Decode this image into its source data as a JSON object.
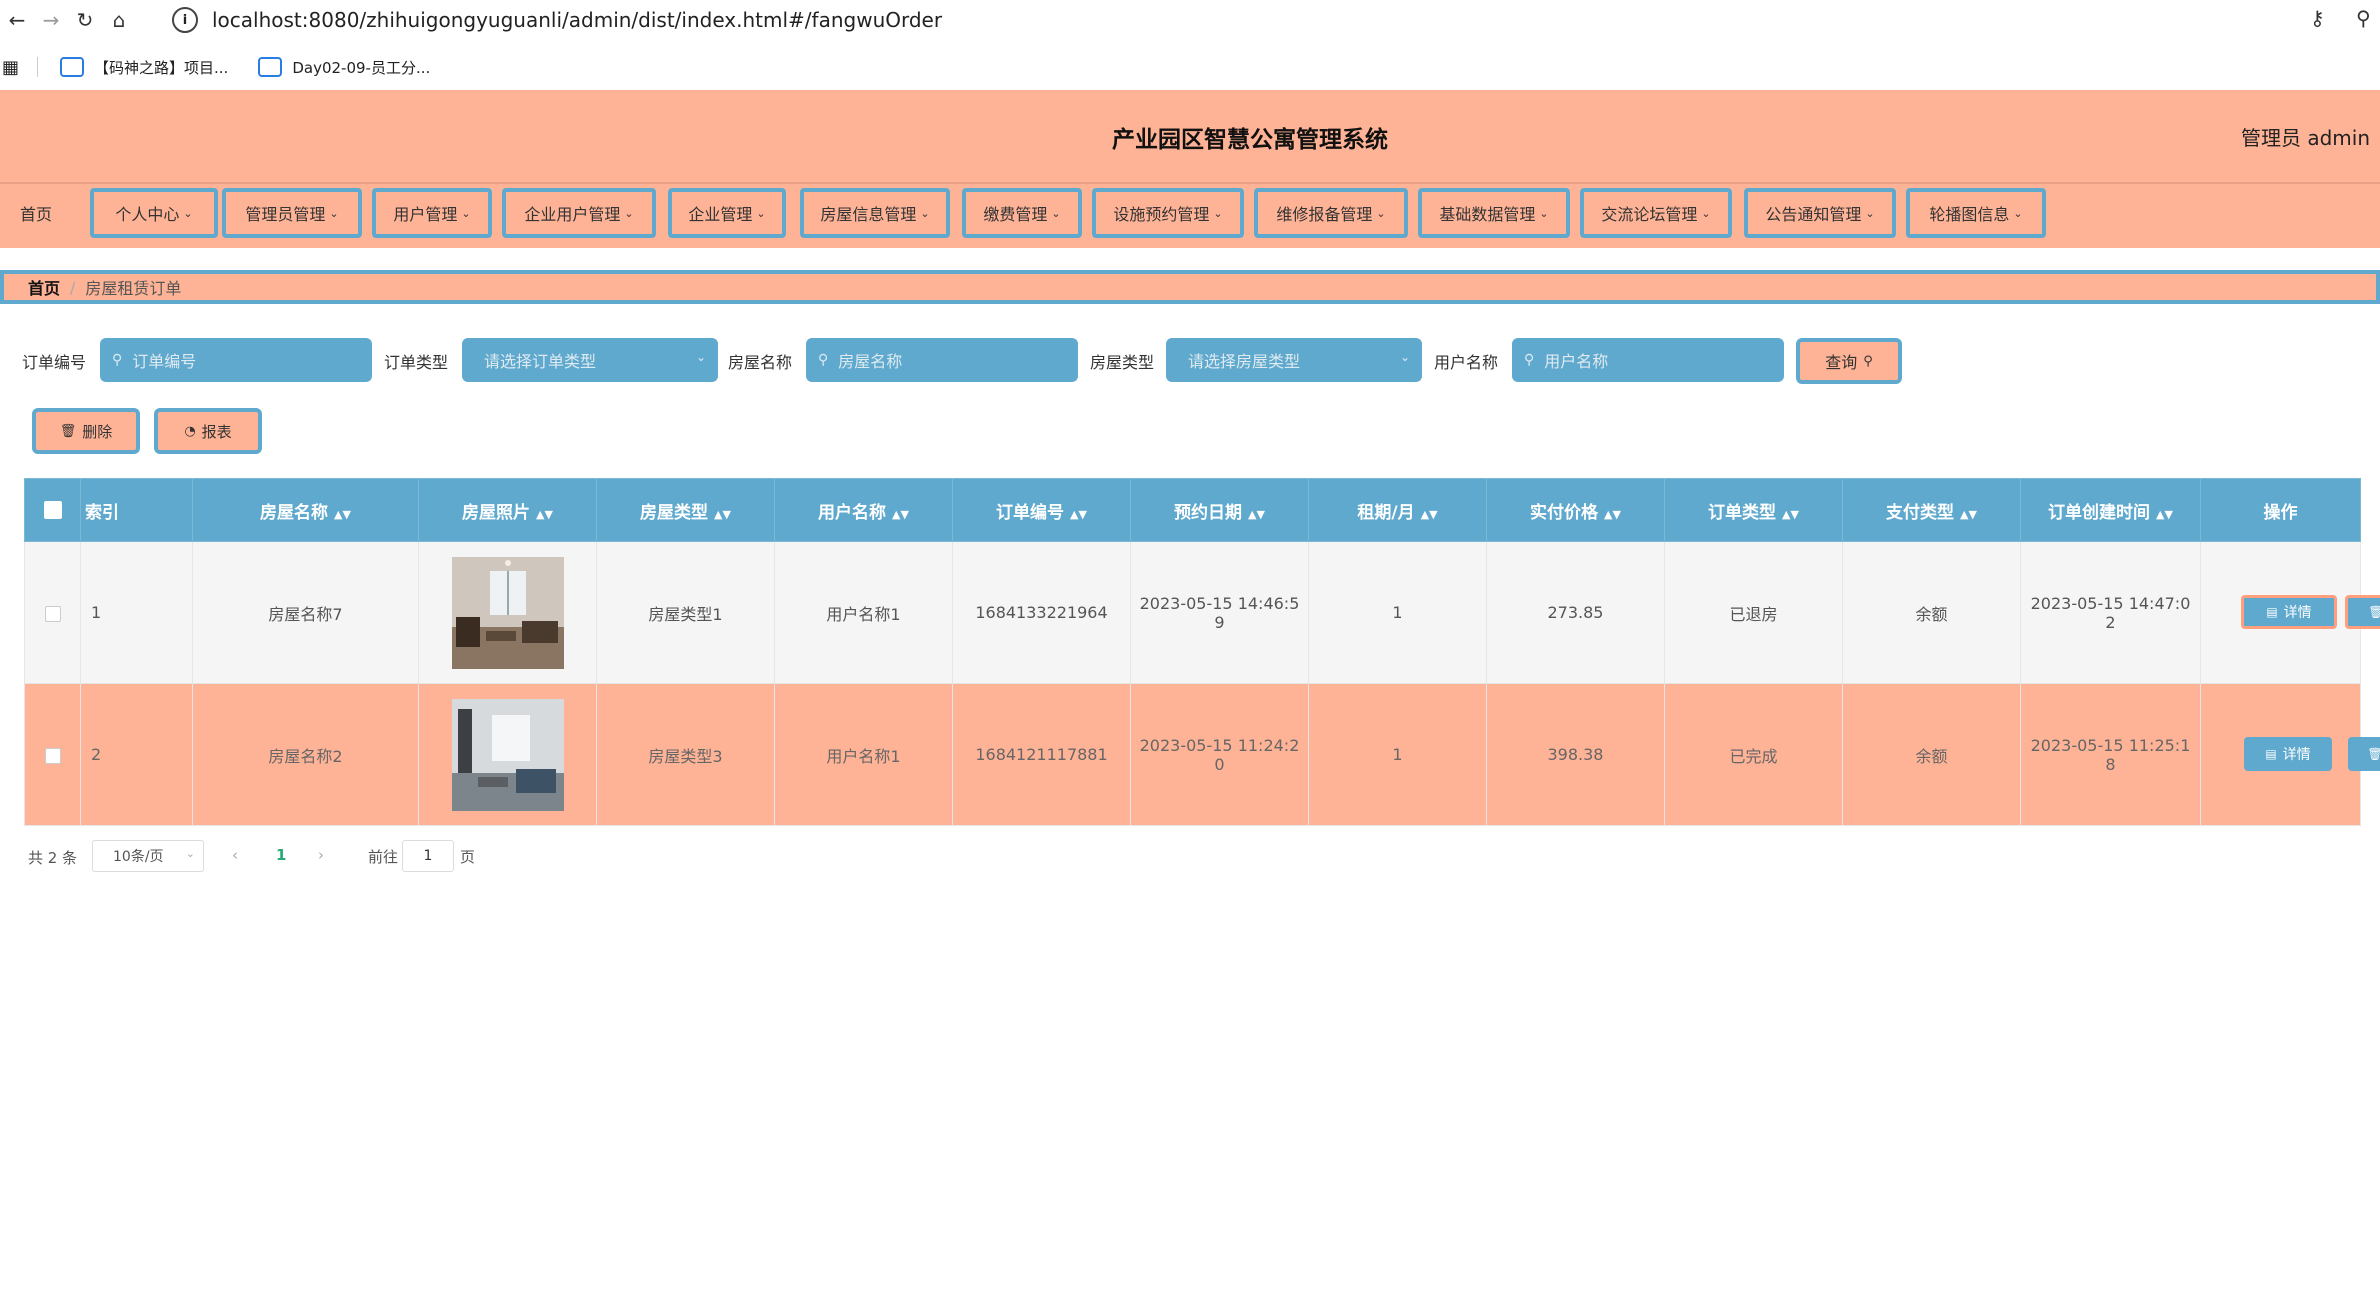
{
  "browser": {
    "url": "localhost:8080/zhihuigongyuguanli/admin/dist/index.html#/fangwuOrder",
    "bookmarks": [
      "【码神之路】项目...",
      "Day02-09-员工分..."
    ]
  },
  "header": {
    "title": "产业园区智慧公寓管理系统",
    "admin": "管理员 admin"
  },
  "menu": [
    "首页",
    "个人中心",
    "管理员管理",
    "用户管理",
    "企业用户管理",
    "企业管理",
    "房屋信息管理",
    "缴费管理",
    "设施预约管理",
    "维修报备管理",
    "基础数据管理",
    "交流论坛管理",
    "公告通知管理",
    "轮播图信息"
  ],
  "breadcrumb": {
    "home": "首页",
    "sep": "/",
    "current": "房屋租赁订单"
  },
  "filters": {
    "order_no_label": "订单编号",
    "order_no_placeholder": "订单编号",
    "order_type_label": "订单类型",
    "order_type_placeholder": "请选择订单类型",
    "house_name_label": "房屋名称",
    "house_name_placeholder": "房屋名称",
    "house_type_label": "房屋类型",
    "house_type_placeholder": "请选择房屋类型",
    "user_name_label": "用户名称",
    "user_name_placeholder": "用户名称",
    "query": "查询"
  },
  "actions": {
    "delete": "删除",
    "report": "报表"
  },
  "table": {
    "headers": [
      "索引",
      "房屋名称",
      "房屋照片",
      "房屋类型",
      "用户名称",
      "订单编号",
      "预约日期",
      "租期/月",
      "实付价格",
      "订单类型",
      "支付类型",
      "订单创建时间",
      "操作"
    ],
    "rows": [
      {
        "index": "1",
        "house_name": "房屋名称7",
        "house_type": "房屋类型1",
        "user_name": "用户名称1",
        "order_no": "1684133221964",
        "date_a": "2023-05-15 14:46:5",
        "date_b": "9",
        "months": "1",
        "price": "273.85",
        "order_type": "已退房",
        "pay_type": "余额",
        "created_a": "2023-05-15 14:47:0",
        "created_b": "2",
        "detail": "详情",
        "del": "删除"
      },
      {
        "index": "2",
        "house_name": "房屋名称2",
        "house_type": "房屋类型3",
        "user_name": "用户名称1",
        "order_no": "1684121117881",
        "date_a": "2023-05-15 11:24:2",
        "date_b": "0",
        "months": "1",
        "price": "398.38",
        "order_type": "已完成",
        "pay_type": "余额",
        "created_a": "2023-05-15 11:25:1",
        "created_b": "8",
        "detail": "详情",
        "del": "删除"
      }
    ]
  },
  "pagination": {
    "total": "共 2 条",
    "page_size": "10条/页",
    "current": "1",
    "goto": "前往",
    "goto_value": "1",
    "page_unit": "页"
  },
  "colors": {
    "salmon": "#ffb396",
    "blue": "#5fa9ce"
  }
}
